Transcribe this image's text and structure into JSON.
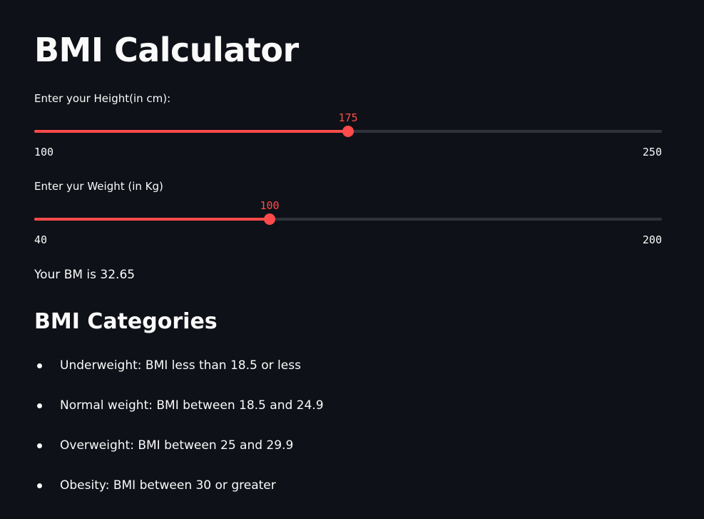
{
  "app": {
    "title": "BMI Calculator"
  },
  "height_slider": {
    "label": "Enter your Height(in cm):",
    "value": 175,
    "min": 100,
    "max": 250
  },
  "weight_slider": {
    "label": "Enter yur Weight (in Kg)",
    "value": 100,
    "min": 40,
    "max": 200
  },
  "result": {
    "text": "Your BM is 32.65"
  },
  "categories": {
    "heading": "BMI Categories",
    "items": [
      "Underweight: BMI less than 18.5 or less",
      "Normal weight: BMI between 18.5 and 24.9",
      "Overweight: BMI between 25 and 29.9",
      "Obesity: BMI between 30 or greater"
    ]
  },
  "colors": {
    "background": "#0e1117",
    "accent": "#ff4b4b",
    "track": "#30333b",
    "text": "#fafafa"
  }
}
